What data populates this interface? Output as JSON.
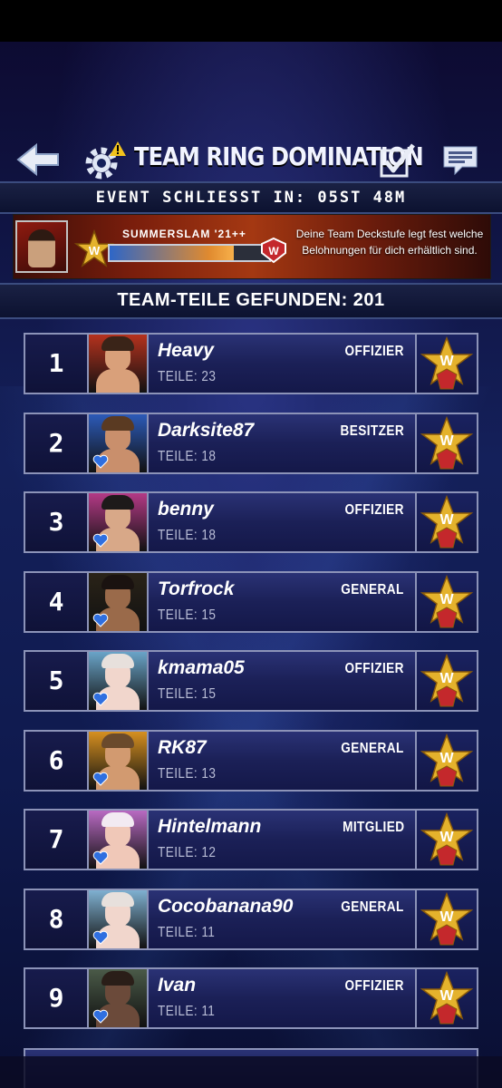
{
  "header": {
    "title": "TEAM RING DOMINATION",
    "back_icon": "arrow-left-icon",
    "settings_icon": "gear-alert-icon",
    "check_icon": "checkbox-checked-icon",
    "chat_icon": "chat-icon"
  },
  "timer": {
    "text": "EVENT SCHLIESST IN: 05ST 48M"
  },
  "banner": {
    "event_name": "SUMMERSLAM '21++",
    "progress": 0.78,
    "info": "Deine Team Deckstufe legt fest welche Belohnungen für dich erhältlich sind."
  },
  "parts_found": {
    "text": "TEAM-TEILE GEFUNDEN: 201"
  },
  "members": [
    {
      "rank": "1",
      "name": "Heavy",
      "role": "OFFIZIER",
      "parts": "TEILE: 23",
      "skin": "#d9a07a",
      "hair": "#3a2418",
      "bg": "#b5321e",
      "heart": false
    },
    {
      "rank": "2",
      "name": "Darksite87",
      "role": "BESITZER",
      "parts": "TEILE: 18",
      "skin": "#c98f6c",
      "hair": "#5a3a22",
      "bg": "#2c5ab8",
      "heart": true
    },
    {
      "rank": "3",
      "name": "benny",
      "role": "OFFIZIER",
      "parts": "TEILE: 18",
      "skin": "#d8a888",
      "hair": "#1d1a1a",
      "bg": "#b33a86",
      "heart": true
    },
    {
      "rank": "4",
      "name": "Torfrock",
      "role": "GENERAL",
      "parts": "TEILE: 15",
      "skin": "#9a6a4a",
      "hair": "#1a1210",
      "bg": "#2a2318",
      "heart": true
    },
    {
      "rank": "5",
      "name": "kmama05",
      "role": "OFFIZIER",
      "parts": "TEILE: 15",
      "skin": "#f1d6cc",
      "hair": "#e7e0dc",
      "bg": "#6aa4c8",
      "heart": true
    },
    {
      "rank": "6",
      "name": "RK87",
      "role": "GENERAL",
      "parts": "TEILE: 13",
      "skin": "#d29a70",
      "hair": "#6a4a2c",
      "bg": "#d69020",
      "heart": true
    },
    {
      "rank": "7",
      "name": "Hintelmann",
      "role": "MITGLIED",
      "parts": "TEILE: 12",
      "skin": "#f0c8b8",
      "hair": "#f2eaf2",
      "bg": "#b86ac2",
      "heart": true
    },
    {
      "rank": "8",
      "name": "Cocobanana90",
      "role": "GENERAL",
      "parts": "TEILE: 11",
      "skin": "#f1d6cc",
      "hair": "#e7e0dc",
      "bg": "#7fb0d0",
      "heart": true
    },
    {
      "rank": "9",
      "name": "Ivan",
      "role": "OFFIZIER",
      "parts": "TEILE: 11",
      "skin": "#6b4a3a",
      "hair": "#2a1e18",
      "bg": "#4a5a48",
      "heart": true
    }
  ],
  "colors": {
    "accent_blue": "#2f6fe0",
    "row_border": "#8c93b8",
    "gold": "#e4b22c",
    "wwe_red": "#c4282c"
  }
}
